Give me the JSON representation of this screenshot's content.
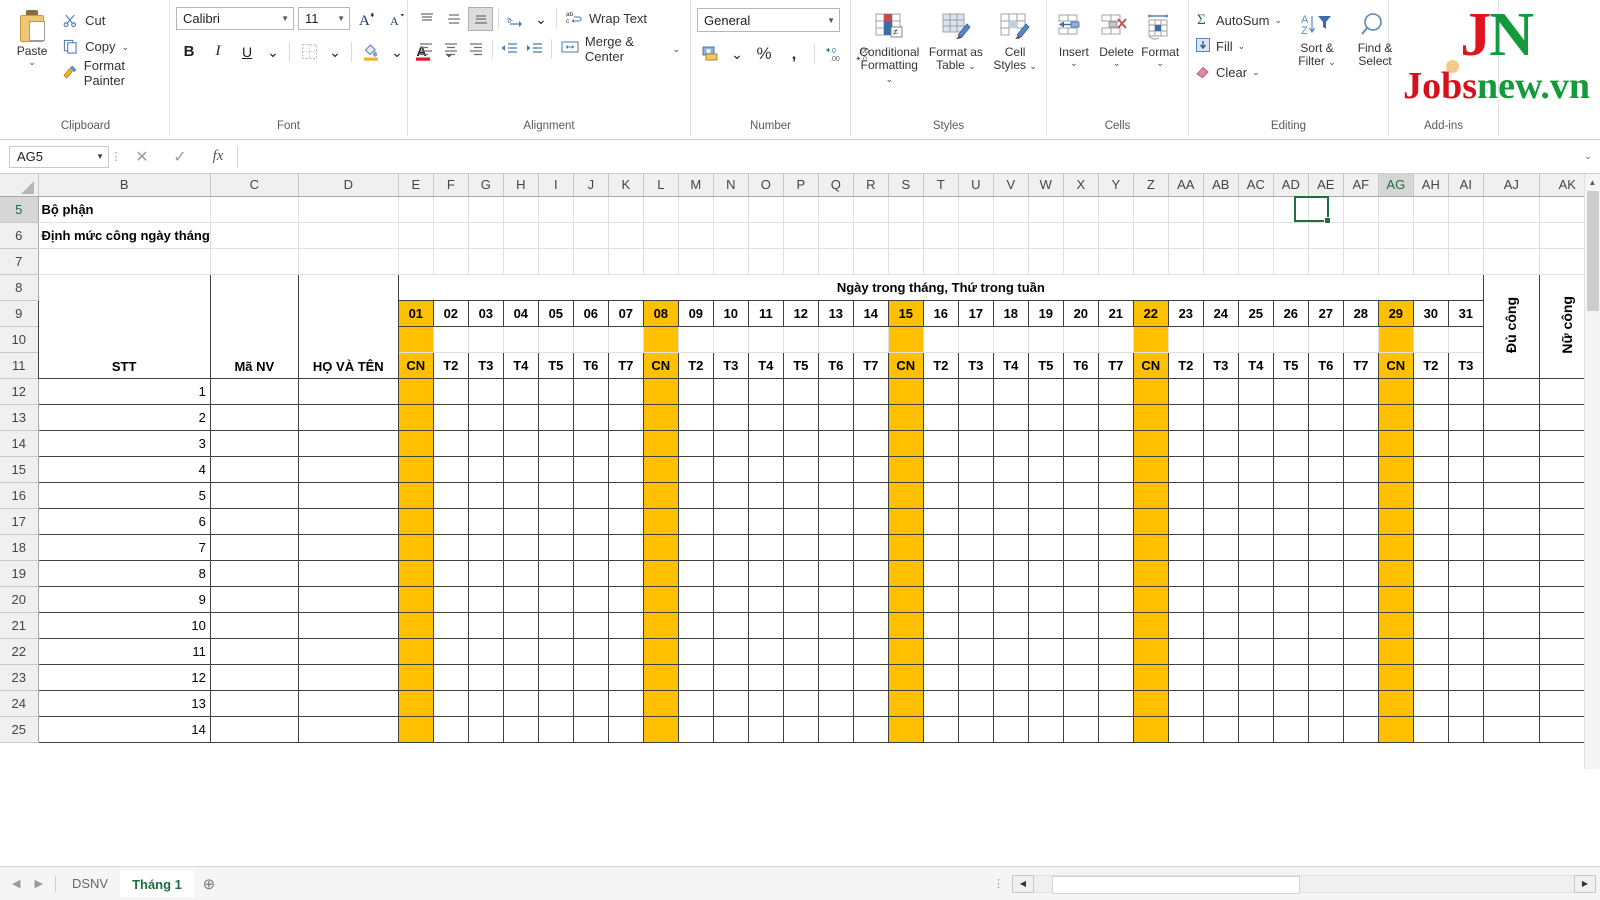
{
  "ribbon": {
    "groups": [
      {
        "label": "Clipboard"
      },
      {
        "label": "Font"
      },
      {
        "label": "Alignment"
      },
      {
        "label": "Number"
      },
      {
        "label": "Styles"
      },
      {
        "label": "Cells"
      },
      {
        "label": "Editing"
      },
      {
        "label": "Add-ins"
      }
    ],
    "clipboard": {
      "paste": "Paste",
      "cut": "Cut",
      "copy": "Copy",
      "format_painter": "Format Painter"
    },
    "font": {
      "family": "Calibri",
      "size": "11",
      "grow_icon": "increase-font-size-icon",
      "shrink_icon": "decrease-font-size-icon",
      "bold": "B",
      "italic": "I",
      "underline": "U",
      "borders_icon": "borders-icon",
      "fill_color_icon": "fill-color-icon",
      "font_color_icon": "font-color-icon"
    },
    "alignment": {
      "wrap_text": "Wrap Text",
      "merge_center": "Merge & Center",
      "orientation_icon": "text-orientation-icon",
      "decrease_indent_icon": "decrease-indent-icon",
      "increase_indent_icon": "increase-indent-icon"
    },
    "number": {
      "format": "General",
      "accounting_icon": "accounting-format-icon",
      "percent": "%",
      "comma": ",",
      "increase_decimal_icon": "increase-decimal-icon",
      "decrease_decimal_icon": "decrease-decimal-icon"
    },
    "styles": {
      "conditional_formatting": "Conditional\nFormatting",
      "conditional_formatting_l1": "Conditional",
      "conditional_formatting_l2": "Formatting",
      "format_as_table_l1": "Format as",
      "format_as_table_l2": "Table",
      "cell_styles_l1": "Cell",
      "cell_styles_l2": "Styles"
    },
    "cells": {
      "insert": "Insert",
      "delete": "Delete",
      "format": "Format"
    },
    "editing": {
      "autosum": "AutoSum",
      "fill": "Fill",
      "clear": "Clear",
      "sort_filter_l1": "Sort &",
      "sort_filter_l2": "Filter",
      "find_select_l1": "Find &",
      "find_select_l2": "Select"
    },
    "watermark": {
      "logo_j": "J",
      "logo_n": "N",
      "text_a": "Jobs",
      "text_b": "new.vn"
    }
  },
  "formula_bar": {
    "name_box": "AG5",
    "cancel_icon": "cancel-icon",
    "enter_icon": "confirm-icon",
    "fx_icon": "insert-function-icon",
    "formula_value": "",
    "expand_icon": "expand-formula-bar-icon"
  },
  "grid": {
    "active_cell": "AG5",
    "active_column": "AG",
    "column_letters": [
      "B",
      "C",
      "D",
      "E",
      "F",
      "G",
      "H",
      "I",
      "J",
      "K",
      "L",
      "M",
      "N",
      "O",
      "P",
      "Q",
      "R",
      "S",
      "T",
      "U",
      "V",
      "W",
      "X",
      "Y",
      "Z",
      "AA",
      "AB",
      "AC",
      "AD",
      "AE",
      "AF",
      "AG",
      "AH",
      "AI",
      "AJ",
      "AK"
    ],
    "row_numbers": [
      "5",
      "6",
      "7",
      "8",
      "9",
      "10",
      "11",
      "12",
      "13",
      "14",
      "15",
      "16",
      "17",
      "18",
      "19",
      "20",
      "21",
      "22",
      "23",
      "24",
      "25"
    ],
    "labels": {
      "bo_phan": "Bộ phận",
      "dinh_muc": "Định mức công ngày tháng",
      "banner": "Ngày trong tháng, Thứ trong tuần",
      "stt": "STT",
      "ma_nv": "Mã NV",
      "ho_va_ten": "HỌ VÀ TÊN",
      "du_cong": "Đủ công",
      "nu_cong": "Nữ công"
    },
    "days": [
      "01",
      "02",
      "03",
      "04",
      "05",
      "06",
      "07",
      "08",
      "09",
      "10",
      "11",
      "12",
      "13",
      "14",
      "15",
      "16",
      "17",
      "18",
      "19",
      "20",
      "21",
      "22",
      "23",
      "24",
      "25",
      "26",
      "27",
      "28",
      "29",
      "30",
      "31"
    ],
    "weekdays": [
      "CN",
      "T2",
      "T3",
      "T4",
      "T5",
      "T6",
      "T7",
      "CN",
      "T2",
      "T3",
      "T4",
      "T5",
      "T6",
      "T7",
      "CN",
      "T2",
      "T3",
      "T4",
      "T5",
      "T6",
      "T7",
      "CN",
      "T2",
      "T3",
      "T4",
      "T5",
      "T6",
      "T7",
      "CN",
      "T2",
      "T3"
    ],
    "sunday_indices": [
      0,
      7,
      14,
      21,
      28
    ],
    "stt_values": [
      "1",
      "2",
      "3",
      "4",
      "5",
      "6",
      "7",
      "8",
      "9",
      "10",
      "11",
      "12",
      "13",
      "14"
    ],
    "colors": {
      "sunday_highlight": "#FFC000",
      "selection": "#1d6f42",
      "header_bg": "#f0f0f0"
    }
  },
  "sheet_tabs": {
    "tabs": [
      {
        "name": "DSNV",
        "active": false
      },
      {
        "name": "Tháng 1",
        "active": true
      }
    ],
    "add_sheet_icon": "add-sheet-icon",
    "prev_icon": "prev-sheet-icon",
    "next_icon": "next-sheet-icon"
  }
}
